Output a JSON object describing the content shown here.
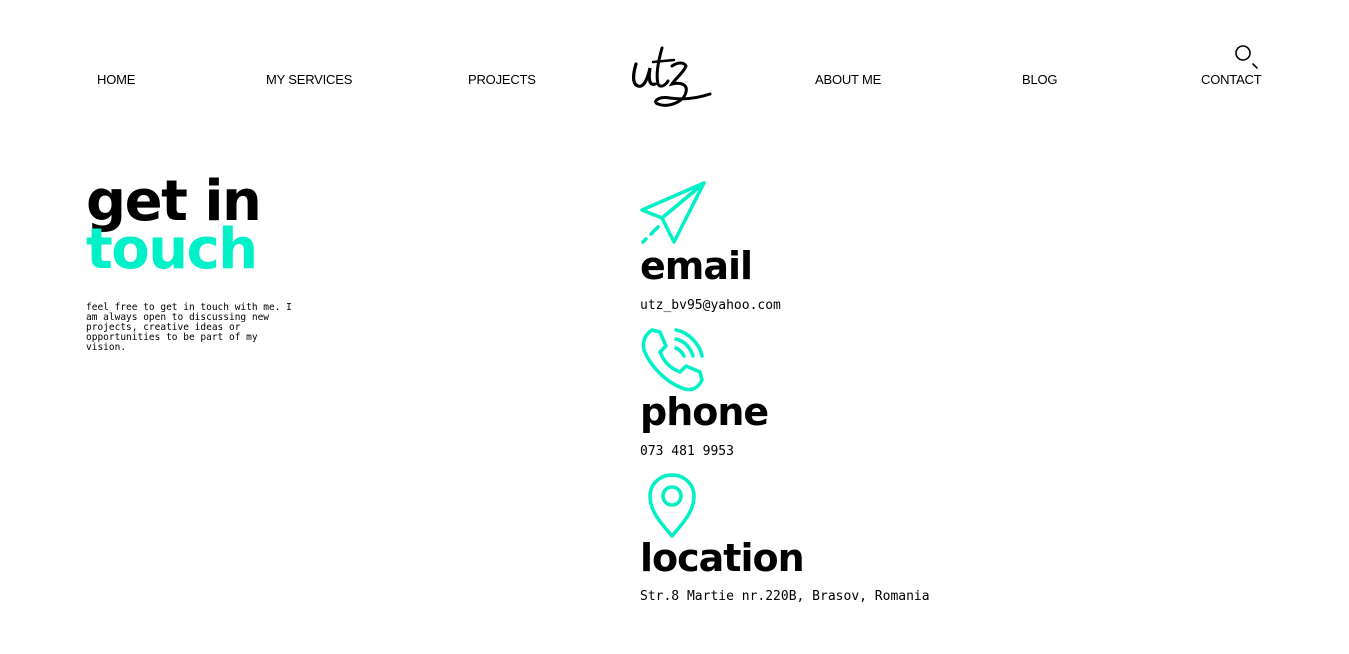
{
  "nav": {
    "home": "HOME",
    "services": "MY SERVICES",
    "projects": "PROJECTS",
    "about": "ABOUT ME",
    "blog": "BLOG",
    "contact": "CONTACT"
  },
  "logo": {
    "text": "utz"
  },
  "hero": {
    "title_line1": "get in",
    "title_line2": "touch",
    "description": "feel free to get in touch with me. I am always open to discussing new projects, creative ideas or opportunities to be part of my vision."
  },
  "contacts": {
    "email": {
      "title": "email",
      "value": "utz_bv95@yahoo.com",
      "icon": "paper-plane-icon"
    },
    "phone": {
      "title": "phone",
      "value": "073 481 9953",
      "icon": "phone-ringing-icon"
    },
    "location": {
      "title": "location",
      "value": "Str.8 Martie nr.220B, Brasov, Romania",
      "icon": "map-pin-icon"
    }
  },
  "colors": {
    "accent": "#00f0c8",
    "text": "#000000",
    "background": "#ffffff"
  }
}
